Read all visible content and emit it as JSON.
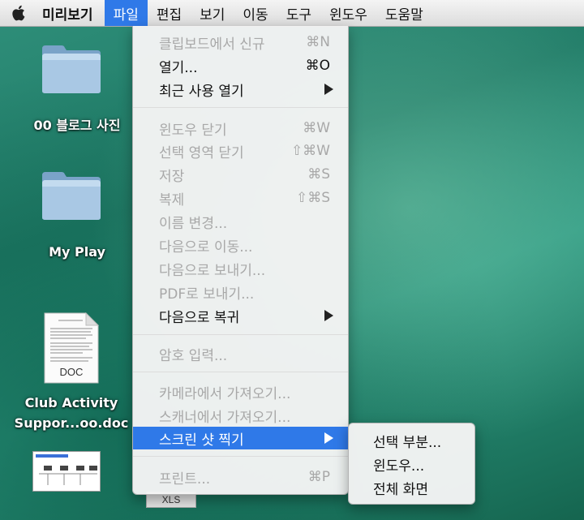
{
  "menubar": {
    "app_name": "미리보기",
    "menus": [
      "파일",
      "편집",
      "보기",
      "이동",
      "도구",
      "윈도우",
      "도움말"
    ]
  },
  "desktop": {
    "items": [
      {
        "label": "00 블로그 사진",
        "icon": "folder-icon"
      },
      {
        "label": "My Play",
        "icon": "folder-icon"
      },
      {
        "label_line1": "Club Activity",
        "label_line2": "Suppor...oo.doc",
        "icon": "doc-icon",
        "badge": "DOC"
      },
      {
        "badge": "XLS",
        "icon": "spreadsheet-icon"
      }
    ]
  },
  "file_menu": {
    "items": [
      {
        "label": "클립보드에서 신규",
        "shortcut": "⌘N",
        "enabled": false
      },
      {
        "label": "열기...",
        "shortcut": "⌘O",
        "enabled": true
      },
      {
        "label": "최근 사용 열기",
        "submenu": true,
        "enabled": true
      },
      {
        "label": "윈도우 닫기",
        "shortcut": "⌘W",
        "enabled": false
      },
      {
        "label": "선택 영역 닫기",
        "shortcut": "⇧⌘W",
        "enabled": false
      },
      {
        "label": "저장",
        "shortcut": "⌘S",
        "enabled": false
      },
      {
        "label": "복제",
        "shortcut": "⇧⌘S",
        "enabled": false
      },
      {
        "label": "이름 변경...",
        "enabled": false
      },
      {
        "label": "다음으로 이동...",
        "enabled": false
      },
      {
        "label": "다음으로 보내기...",
        "enabled": false
      },
      {
        "label": "PDF로 보내기...",
        "enabled": false
      },
      {
        "label": "다음으로 복귀",
        "submenu": true,
        "enabled": true
      },
      {
        "label": "암호 입력...",
        "enabled": false
      },
      {
        "label": "카메라에서 가져오기...",
        "enabled": false
      },
      {
        "label": "스캐너에서 가져오기...",
        "enabled": false
      },
      {
        "label": "스크린 샷 찍기",
        "submenu": true,
        "enabled": true,
        "highlighted": true
      },
      {
        "label": "프린트...",
        "shortcut": "⌘P",
        "enabled": false
      }
    ]
  },
  "screenshot_submenu": {
    "items": [
      "선택 부분...",
      "윈도우...",
      "전체 화면"
    ]
  },
  "colors": {
    "highlight": "#2f79e8",
    "disabled_text": "#a8a8a8",
    "desktop": "#2e8f78"
  }
}
